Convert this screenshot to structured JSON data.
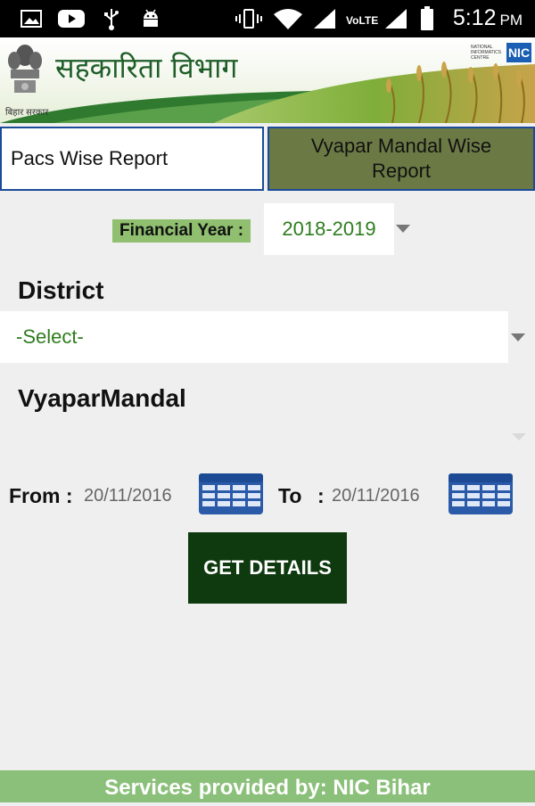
{
  "status_bar": {
    "time": "5:12",
    "ampm": "PM",
    "volte": "VoLTE",
    "icons": [
      "image-icon",
      "video-icon",
      "usb-icon",
      "android-icon",
      "vibrate-icon",
      "wifi-icon",
      "signal-icon",
      "signal-icon",
      "battery-icon"
    ]
  },
  "banner": {
    "title": "सहकारिता विभाग",
    "subtitle": "बिहार सरकार",
    "nic_text": "NIC",
    "nic_caption": "NATIONAL INFORMATICS CENTRE"
  },
  "tabs": {
    "pacs": "Pacs Wise Report",
    "vyapar": "Vyapar Mandal Wise Report"
  },
  "financial_year": {
    "label": "Financial Year :",
    "value": "2018-2019"
  },
  "district": {
    "label": "District",
    "value": "-Select-"
  },
  "vyapar_mandal": {
    "label": "VyaparMandal",
    "value": ""
  },
  "date_range": {
    "from_label": "From :",
    "from_value": "20/11/2016",
    "to_label": "To",
    "to_separator": ":",
    "to_value": "20/11/2016"
  },
  "actions": {
    "get_details": "GET DETAILS"
  },
  "footer": {
    "text": "Services provided by: NIC Bihar"
  },
  "colors": {
    "accent_green": "#2e7d1e",
    "button_dark": "#0f3a0f",
    "footer_green": "#8bc07a",
    "tab_inactive": "#6b7a45",
    "tab_border": "#1a4a99"
  }
}
